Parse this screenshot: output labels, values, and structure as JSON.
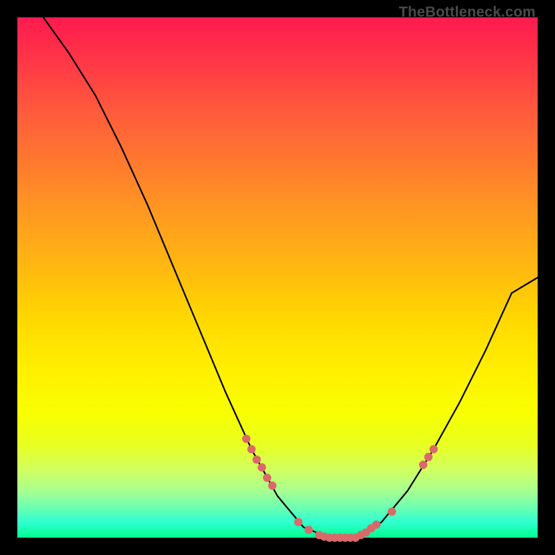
{
  "watermark": "TheBottleneck.com",
  "chart_data": {
    "type": "line",
    "title": "",
    "xlabel": "",
    "ylabel": "",
    "xlim": [
      0,
      100
    ],
    "ylim": [
      0,
      100
    ],
    "grid": false,
    "legend": false,
    "curve": [
      {
        "x": 5,
        "y": 100
      },
      {
        "x": 10,
        "y": 93
      },
      {
        "x": 15,
        "y": 85
      },
      {
        "x": 20,
        "y": 75
      },
      {
        "x": 25,
        "y": 64
      },
      {
        "x": 30,
        "y": 52
      },
      {
        "x": 35,
        "y": 40
      },
      {
        "x": 40,
        "y": 28
      },
      {
        "x": 45,
        "y": 17
      },
      {
        "x": 50,
        "y": 8
      },
      {
        "x": 55,
        "y": 2
      },
      {
        "x": 60,
        "y": 0
      },
      {
        "x": 65,
        "y": 0
      },
      {
        "x": 67,
        "y": 1
      },
      {
        "x": 70,
        "y": 3
      },
      {
        "x": 75,
        "y": 9
      },
      {
        "x": 80,
        "y": 17
      },
      {
        "x": 85,
        "y": 26
      },
      {
        "x": 90,
        "y": 36
      },
      {
        "x": 95,
        "y": 47
      },
      {
        "x": 100,
        "y": 50
      }
    ],
    "markers": [
      {
        "x": 44,
        "y": 19
      },
      {
        "x": 45,
        "y": 17
      },
      {
        "x": 46,
        "y": 15
      },
      {
        "x": 47,
        "y": 13.5
      },
      {
        "x": 48,
        "y": 11.5
      },
      {
        "x": 49,
        "y": 10
      },
      {
        "x": 54,
        "y": 3
      },
      {
        "x": 56,
        "y": 1.5
      },
      {
        "x": 58,
        "y": 0.5
      },
      {
        "x": 59,
        "y": 0.2
      },
      {
        "x": 60,
        "y": 0
      },
      {
        "x": 61,
        "y": 0
      },
      {
        "x": 62,
        "y": 0
      },
      {
        "x": 63,
        "y": 0
      },
      {
        "x": 64,
        "y": 0
      },
      {
        "x": 65,
        "y": 0
      },
      {
        "x": 66,
        "y": 0.5
      },
      {
        "x": 67,
        "y": 1
      },
      {
        "x": 68,
        "y": 1.8
      },
      {
        "x": 69,
        "y": 2.5
      },
      {
        "x": 72,
        "y": 5
      },
      {
        "x": 78,
        "y": 14
      },
      {
        "x": 79,
        "y": 15.5
      },
      {
        "x": 80,
        "y": 17
      }
    ]
  }
}
